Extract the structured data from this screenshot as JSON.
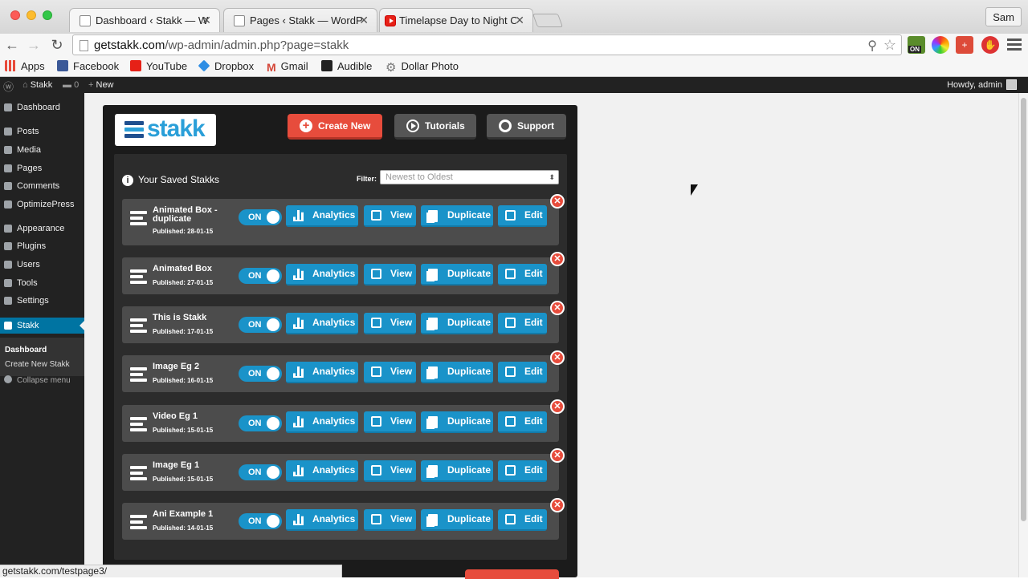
{
  "browser": {
    "tabs": [
      {
        "label": "Dashboard ‹ Stakk — Word",
        "active": true,
        "icon": "page-icon"
      },
      {
        "label": "Pages ‹ Stakk — WordPres",
        "active": false,
        "icon": "page-icon"
      },
      {
        "label": "Timelapse Day to Night Cit",
        "active": false,
        "icon": "youtube-icon"
      }
    ],
    "profile": "Sam",
    "url_host": "getstakk.com",
    "url_path": "/wp-admin/admin.php?page=stakk",
    "bookmarks": [
      {
        "label": "Apps",
        "icon": "apps-grid-icon",
        "color": "#e84a3a"
      },
      {
        "label": "Facebook",
        "icon": "facebook-icon",
        "color": "#3b5998"
      },
      {
        "label": "YouTube",
        "icon": "youtube-icon",
        "color": "#e62117"
      },
      {
        "label": "Dropbox",
        "icon": "dropbox-icon",
        "color": "#2f8ee4"
      },
      {
        "label": "Gmail",
        "icon": "gmail-icon",
        "color": "#d44638"
      },
      {
        "label": "Audible",
        "icon": "audible-icon",
        "color": "#222222"
      },
      {
        "label": "Dollar Photo",
        "icon": "gear-icon",
        "color": "#777777"
      }
    ],
    "status_url": "getstakk.com/testpage3/"
  },
  "adminbar": {
    "site": "Stakk",
    "comments": "0",
    "new": "New",
    "howdy": "Howdy, admin"
  },
  "menu": {
    "items": [
      "Dashboard",
      "Posts",
      "Media",
      "Pages",
      "Comments",
      "OptimizePress",
      "Appearance",
      "Plugins",
      "Users",
      "Tools",
      "Settings",
      "Stakk"
    ],
    "current": "Stakk",
    "submenu": [
      "Dashboard",
      "Create New Stakk"
    ],
    "collapse": "Collapse menu"
  },
  "app": {
    "logo": "stakk",
    "create_label": "Create New",
    "tutorials_label": "Tutorials",
    "support_label": "Support",
    "saved_title": "Your Saved Stakks",
    "filter_label": "Filter:",
    "filter_value": "Newest to Oldest",
    "toggle_label": "ON",
    "actions": {
      "analytics": "Analytics",
      "view": "View",
      "duplicate": "Duplicate",
      "edit": "Edit"
    },
    "stakks": [
      {
        "title": "Animated Box - duplicate",
        "date": "Published: 28-01-15"
      },
      {
        "title": "Animated Box",
        "date": "Published: 27-01-15"
      },
      {
        "title": "This is Stakk",
        "date": "Published: 17-01-15"
      },
      {
        "title": "Image Eg 2",
        "date": "Published: 16-01-15"
      },
      {
        "title": "Video Eg 1",
        "date": "Published: 15-01-15"
      },
      {
        "title": "Image Eg 1",
        "date": "Published: 15-01-15"
      },
      {
        "title": "Ani Example 1",
        "date": "Published: 14-01-15"
      }
    ],
    "colors": {
      "accent": "#1a93c9",
      "danger": "#e74c3c",
      "panel": "#1b1b1b"
    }
  }
}
